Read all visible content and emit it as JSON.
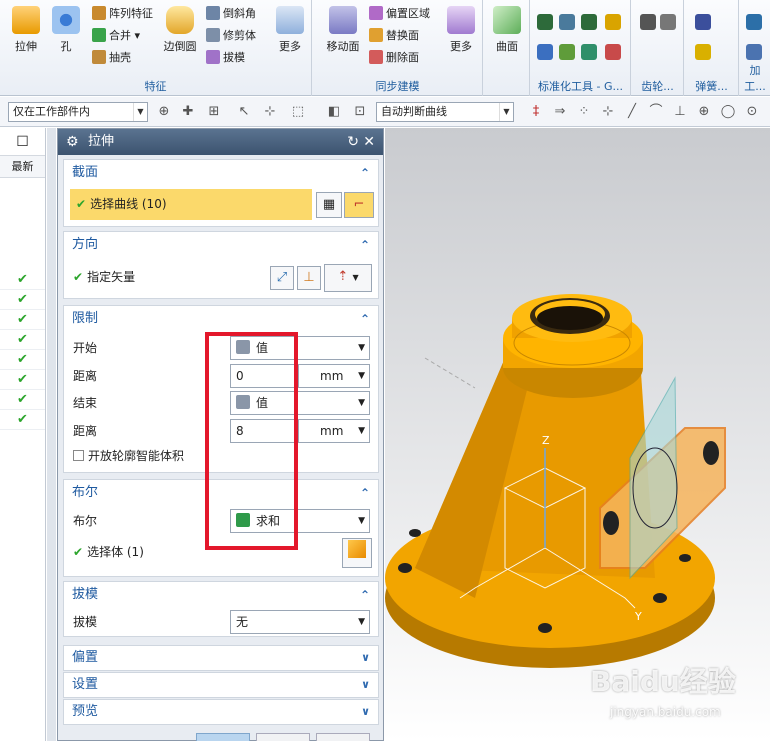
{
  "ribbon": {
    "groups": [
      {
        "label": "特征"
      },
      {
        "label": "同步建模"
      },
      {
        "label": "标准化工具 - G..."
      },
      {
        "label": "齿轮..."
      },
      {
        "label": "弹簧..."
      },
      {
        "label": "加工..."
      }
    ],
    "buttons": {
      "extrude": "拉伸",
      "hole": "孔",
      "pattern": "阵列特征",
      "unite": "合并",
      "shell": "抽壳",
      "edge_blend": "边倒圆",
      "chamfer": "倒斜角",
      "trim_body": "修剪体",
      "draft": "拔模",
      "more1": "更多",
      "move_face": "移动面",
      "offset_region": "偏置区域",
      "replace_face": "替换面",
      "delete_face": "删除面",
      "more2": "更多",
      "surface": "曲面"
    }
  },
  "toolbar": {
    "filter_select": "仅在工作部件内",
    "curve_rule": "自动判断曲线"
  },
  "navigator": {
    "column_header": "最新",
    "checks": [
      "✔",
      "✔",
      "✔",
      "✔",
      "✔",
      "✔",
      "✔",
      "✔"
    ]
  },
  "dialog": {
    "title": "拉伸",
    "section": {
      "title": "截面",
      "select_curve": "选择曲线 (10)"
    },
    "direction": {
      "title": "方向",
      "specify_vector": "指定矢量"
    },
    "limits": {
      "title": "限制",
      "start_label": "开始",
      "start_value": "值",
      "distance_label1": "距离",
      "distance_value1": "0",
      "unit1": "mm",
      "end_label": "结束",
      "end_value": "值",
      "distance_label2": "距离",
      "distance_value2": "8",
      "unit2": "mm",
      "open_profile": "开放轮廓智能体积"
    },
    "boolean": {
      "title": "布尔",
      "label": "布尔",
      "value": "求和",
      "select_body": "选择体 (1)"
    },
    "draft": {
      "title": "拔模",
      "label": "拔模",
      "value": "无"
    },
    "collapsed": [
      "偏置",
      "设置",
      "预览"
    ]
  },
  "watermark": {
    "logo": "Baidu经验",
    "url": "jingyan.baidu.com"
  },
  "colors": {
    "model_orange": "#f2a500",
    "accent_red": "#e3172b",
    "title_bar": "#3c536f",
    "check_green": "#2ca52c"
  }
}
